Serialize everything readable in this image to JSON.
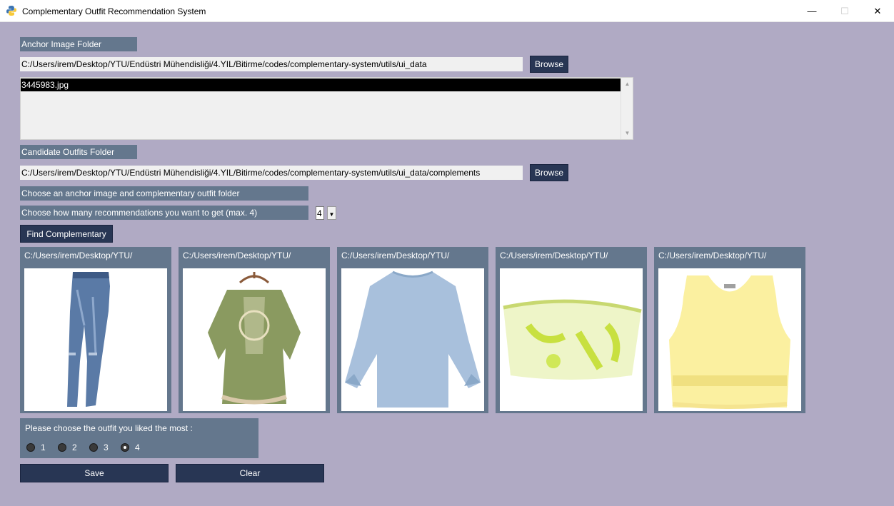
{
  "window": {
    "title": "Complementary Outfit Recommendation System",
    "minimize": "—",
    "maximize": "☐",
    "close": "✕"
  },
  "anchor": {
    "label": "Anchor Image Folder",
    "path": "C:/Users/irem/Desktop/YTU/Endüstri Mühendisliği/4.YIL/Bitirme/codes/complementary-system/utils/ui_data",
    "browse_label": "Browse",
    "files": [
      "3445983.jpg"
    ]
  },
  "candidate": {
    "label": "Candidate Outfits Folder",
    "path": "C:/Users/irem/Desktop/YTU/Endüstri Mühendisliği/4.YIL/Bitirme/codes/complementary-system/utils/ui_data/complements",
    "browse_label": "Browse"
  },
  "status_text": "Choose an anchor image and complementary outfit folder",
  "count_prompt": "Choose how many recommendations you want to get (max. 4)",
  "count_value": "4",
  "find_label": "Find Complementary",
  "results": [
    {
      "path": "C:/Users/irem/Desktop/YTU/",
      "image": "jeans"
    },
    {
      "path": "C:/Users/irem/Desktop/YTU/",
      "image": "green-blouse"
    },
    {
      "path": "C:/Users/irem/Desktop/YTU/",
      "image": "blue-top"
    },
    {
      "path": "C:/Users/irem/Desktop/YTU/",
      "image": "bandeau-top"
    },
    {
      "path": "C:/Users/irem/Desktop/YTU/",
      "image": "yellow-tank"
    }
  ],
  "choice": {
    "prompt": "Please choose the outfit you liked the most :",
    "options": [
      "1",
      "2",
      "3",
      "4"
    ],
    "selected": "4"
  },
  "save_label": "Save",
  "clear_label": "Clear",
  "colors": {
    "background": "#b0aac4",
    "panel": "#64778d",
    "button": "#283654"
  }
}
